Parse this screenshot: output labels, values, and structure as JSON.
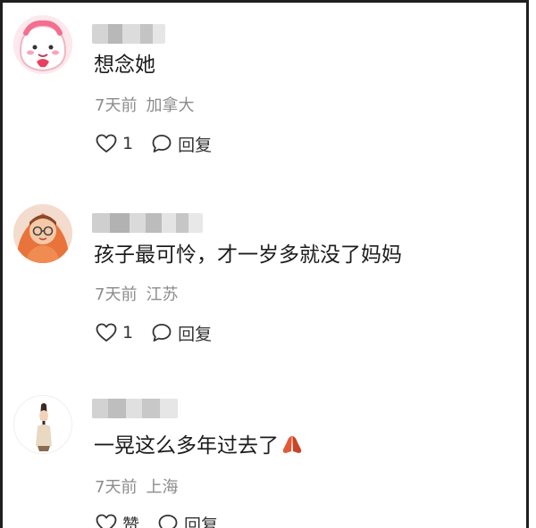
{
  "comments": [
    {
      "content": "想念她",
      "time": "7天前",
      "location": "加拿大",
      "like_label": "1",
      "reply_label": "回复"
    },
    {
      "content": "孩子最可怜，才一岁多就没了妈妈",
      "time": "7天前",
      "location": "江苏",
      "like_label": "1",
      "reply_label": "回复"
    },
    {
      "content": "一晃这么多年过去了",
      "emoji": "praying-hands",
      "time": "7天前",
      "location": "上海",
      "like_label": "赞",
      "reply_label": "回复"
    }
  ],
  "icons": {
    "like": "heart-outline-icon",
    "reply": "speech-bubble-icon"
  },
  "colors": {
    "text": "#1c1c1c",
    "meta": "#8c8c8c",
    "border": "#1f1f1f"
  }
}
